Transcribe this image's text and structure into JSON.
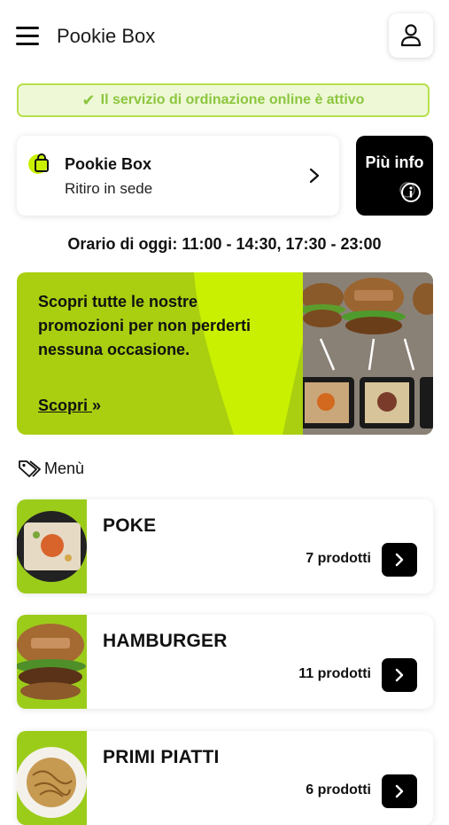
{
  "header": {
    "title": "Pookie Box",
    "menu_icon": "hamburger-icon",
    "account_icon": "user-icon"
  },
  "status_banner": {
    "text": "Il servizio di ordinazione online è attivo",
    "icon": "check-icon",
    "color": "#8cc63f"
  },
  "store": {
    "name": "Pookie Box",
    "mode": "Ritiro in sede",
    "icon": "shopping-bag-icon"
  },
  "info_button": {
    "label": "Più info",
    "icon": "info-icon"
  },
  "hours": {
    "text": "Orario di oggi: 11:00 - 14:30, 17:30 - 23:00"
  },
  "promo": {
    "text": "Scopri tutte le nostre promozioni per non perderti nessuna occasione.",
    "link_label": "Scopri",
    "link_icon": "double-chevron-right-icon",
    "accent_color": "#c8f000"
  },
  "menu": {
    "heading": "Menù",
    "heading_icon": "tag-icon",
    "categories": [
      {
        "name": "POKE",
        "count": "7 prodotti"
      },
      {
        "name": "HAMBURGER",
        "count": "11 prodotti"
      },
      {
        "name": "PRIMI PIATTI",
        "count": "6 prodotti"
      }
    ]
  }
}
